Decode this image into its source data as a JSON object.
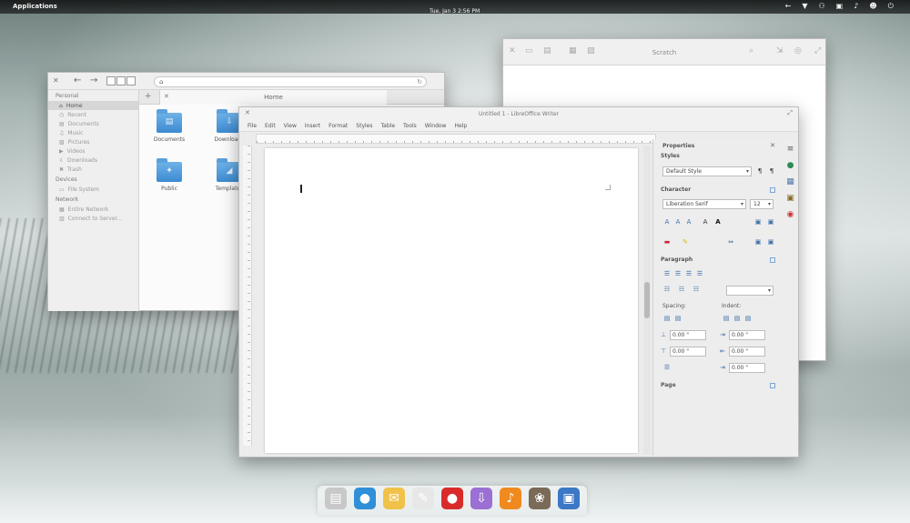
{
  "top_panel": {
    "applications": "Applications",
    "clock": "Tue, Jan 3   2:56 PM",
    "indicators": [
      "←",
      "▼",
      "⚇",
      "▣",
      "♪",
      "☻",
      "⏻"
    ]
  },
  "file_manager": {
    "sidebar": {
      "personal_heading": "Personal",
      "personal_items": [
        {
          "label": "Home",
          "icon": "home-icon",
          "glyph": "⌂"
        },
        {
          "label": "Recent",
          "icon": "clock-icon",
          "glyph": "◷"
        },
        {
          "label": "Documents",
          "icon": "document-icon",
          "glyph": "▤"
        },
        {
          "label": "Music",
          "icon": "music-icon",
          "glyph": "♫"
        },
        {
          "label": "Pictures",
          "icon": "pictures-icon",
          "glyph": "▧"
        },
        {
          "label": "Videos",
          "icon": "video-icon",
          "glyph": "▶"
        },
        {
          "label": "Downloads",
          "icon": "download-icon",
          "glyph": "⇩"
        },
        {
          "label": "Trash",
          "icon": "trash-icon",
          "glyph": "✖"
        }
      ],
      "devices_heading": "Devices",
      "devices_items": [
        {
          "label": "File System",
          "icon": "drive-icon",
          "glyph": "▭"
        }
      ],
      "network_heading": "Network",
      "network_items": [
        {
          "label": "Entire Network",
          "icon": "network-icon",
          "glyph": "▦"
        },
        {
          "label": "Connect to Server...",
          "icon": "server-icon",
          "glyph": "▥"
        }
      ]
    },
    "tab_label": "Home",
    "folders": [
      {
        "label": "Documents",
        "glyph": "▤"
      },
      {
        "label": "Downloads",
        "glyph": "⇩"
      },
      {
        "label": "Public",
        "glyph": "✦"
      },
      {
        "label": "Templates",
        "glyph": "◢"
      }
    ]
  },
  "scratch": {
    "title": "Scratch"
  },
  "writer": {
    "title": "Untitled 1 - LibreOffice Writer",
    "menu": [
      "File",
      "Edit",
      "View",
      "Insert",
      "Format",
      "Styles",
      "Table",
      "Tools",
      "Window",
      "Help"
    ],
    "properties": {
      "heading": "Properties",
      "styles_heading": "Styles",
      "style_value": "Default Style",
      "character_heading": "Character",
      "font_value": "Liberation Serif",
      "size_value": "12",
      "paragraph_heading": "Paragraph",
      "spacing_label": "Spacing:",
      "indent_label": "Indent:",
      "spacing_above": "0.00 \"",
      "spacing_below": "0.00 \"",
      "indent_before": "0.00 \"",
      "indent_after": "0.00 \"",
      "indent_first": "0.00 \"",
      "page_heading": "Page"
    }
  },
  "dock": [
    {
      "name": "files",
      "color": "#c8c8c8",
      "glyph": "▤"
    },
    {
      "name": "browser",
      "color": "#2f8fd8",
      "glyph": "●"
    },
    {
      "name": "mail",
      "color": "#f0c24a",
      "glyph": "✉"
    },
    {
      "name": "text-editor",
      "color": "#e7e7e7",
      "glyph": "✎"
    },
    {
      "name": "tomato",
      "color": "#d92b2b",
      "glyph": "●"
    },
    {
      "name": "app-center",
      "color": "#9b6fd3",
      "glyph": "⇩"
    },
    {
      "name": "music",
      "color": "#f08a1e",
      "glyph": "♪"
    },
    {
      "name": "gimp",
      "color": "#7a6a58",
      "glyph": "❀"
    },
    {
      "name": "writer",
      "color": "#3b78c6",
      "glyph": "▣"
    }
  ]
}
